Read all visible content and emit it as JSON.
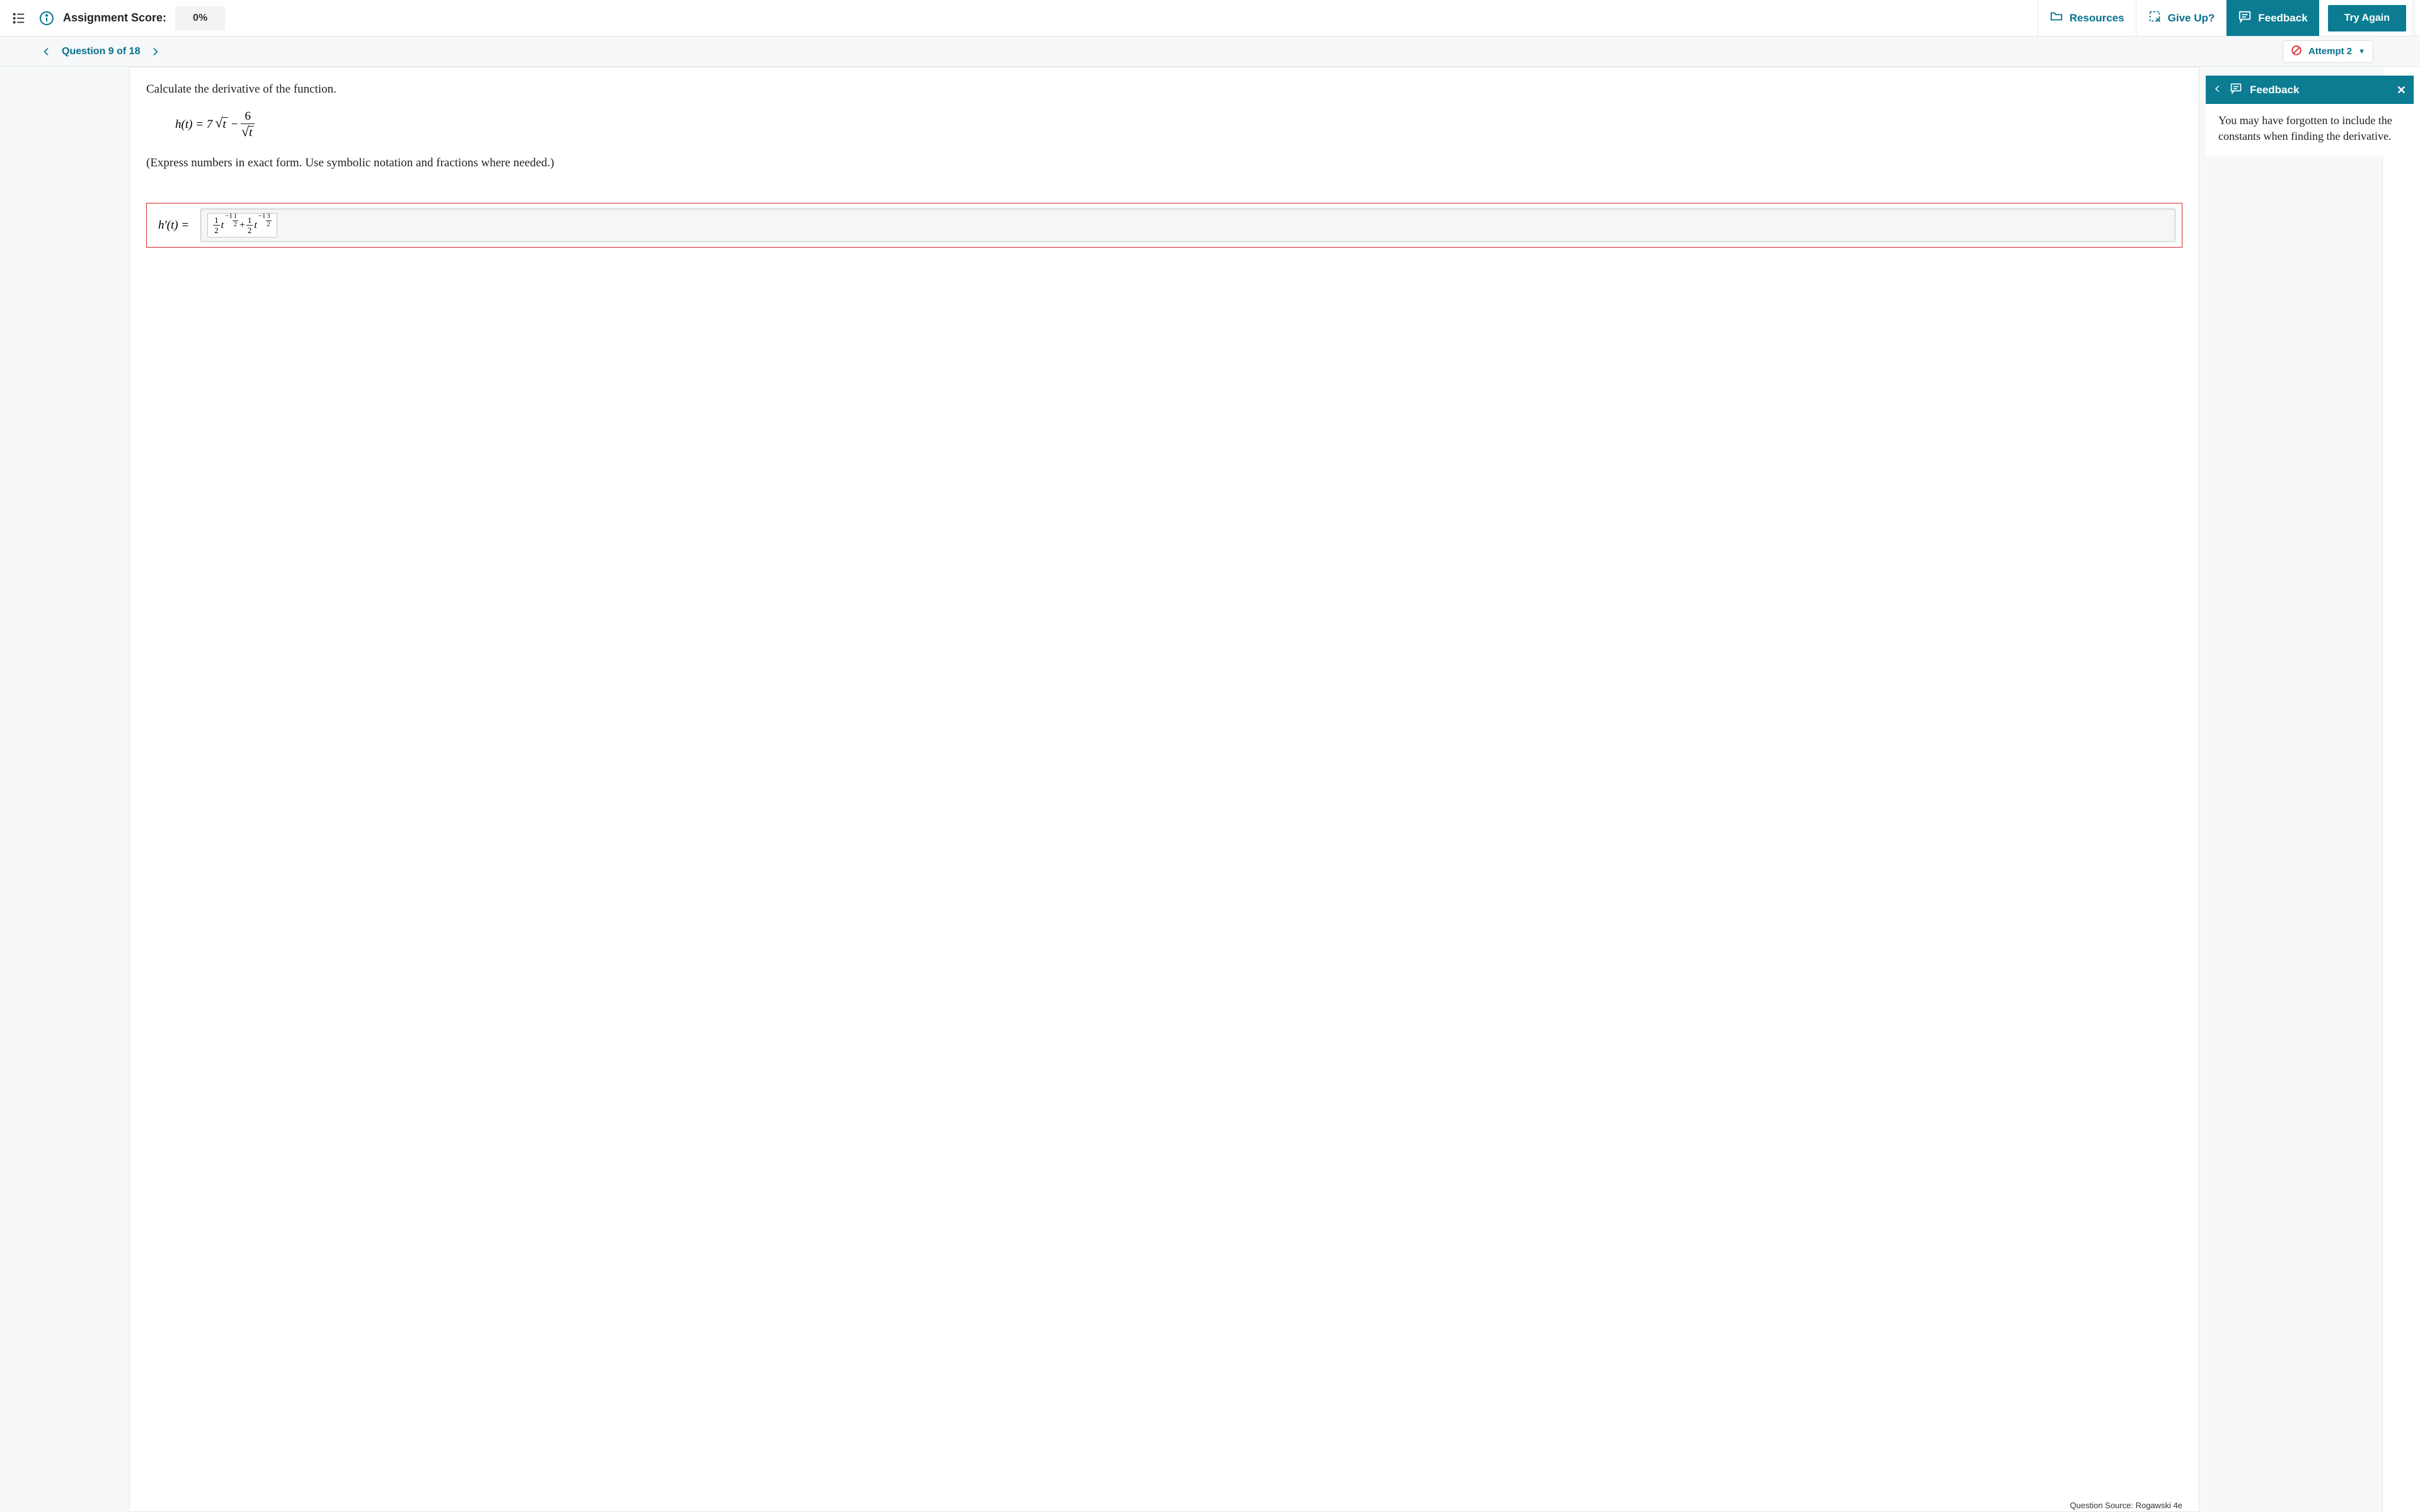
{
  "topbar": {
    "score_label": "Assignment Score:",
    "score_value": "0%",
    "resources": "Resources",
    "giveup": "Give Up?",
    "feedback": "Feedback",
    "tryagain": "Try Again"
  },
  "subbar": {
    "question_label": "Question 9 of 18",
    "attempt_label": "Attempt 2"
  },
  "question": {
    "prompt": "Calculate the derivative of the function.",
    "eq_lhs": "h(t) = 7",
    "eq_var": "t",
    "eq_minus": " − ",
    "eq_frac_num": "6",
    "eq_frac_den_var": "t",
    "instruction": "(Express numbers in exact form. Use symbolic notation and fractions where needed.)",
    "answer_label": "h′(t) =",
    "entered_answer": {
      "c1_num": "1",
      "c1_den": "2",
      "e1_whole": "−1",
      "e1_num": "1",
      "e1_den": "2",
      "plus": " + ",
      "c2_num": "1",
      "c2_den": "2",
      "e2_whole": "−1",
      "e2_num": "3",
      "e2_den": "2",
      "var": "t"
    },
    "source": "Question Source: Rogawski 4e"
  },
  "feedback_panel": {
    "title": "Feedback",
    "body": "You may have forgotten to include the constants when finding the derivative."
  }
}
